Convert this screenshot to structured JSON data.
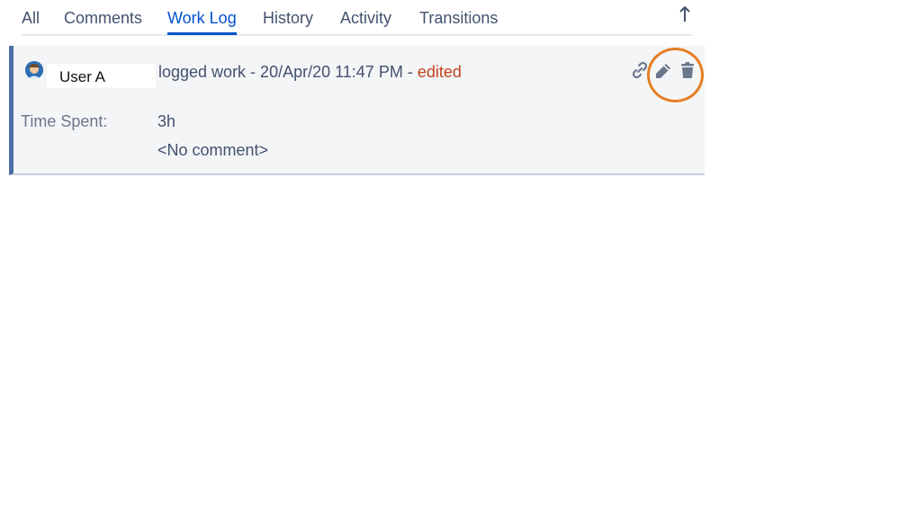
{
  "tabs": [
    {
      "label": "All",
      "active": false
    },
    {
      "label": "Comments",
      "active": false
    },
    {
      "label": "Work Log",
      "active": true
    },
    {
      "label": "History",
      "active": false
    },
    {
      "label": "Activity",
      "active": false
    },
    {
      "label": "Transitions",
      "active": false
    }
  ],
  "scroll_top_icon": "arrow-up-icon",
  "worklog_entry": {
    "avatar_icon": "user-avatar-icon",
    "user_name": "User A",
    "action_text": "logged work - 20/Apr/20 11:47 PM - ",
    "edited_label": "edited",
    "actions": [
      {
        "name": "link-icon"
      },
      {
        "name": "pencil-icon"
      },
      {
        "name": "trash-icon"
      }
    ],
    "time_spent_label": "Time Spent:",
    "time_spent_value": "3h",
    "comment": "<No comment>"
  },
  "colors": {
    "accent": "#0052cc",
    "edited": "#c1431f",
    "highlight_ring": "#e67e22",
    "entry_border": "#4a6fa5"
  }
}
